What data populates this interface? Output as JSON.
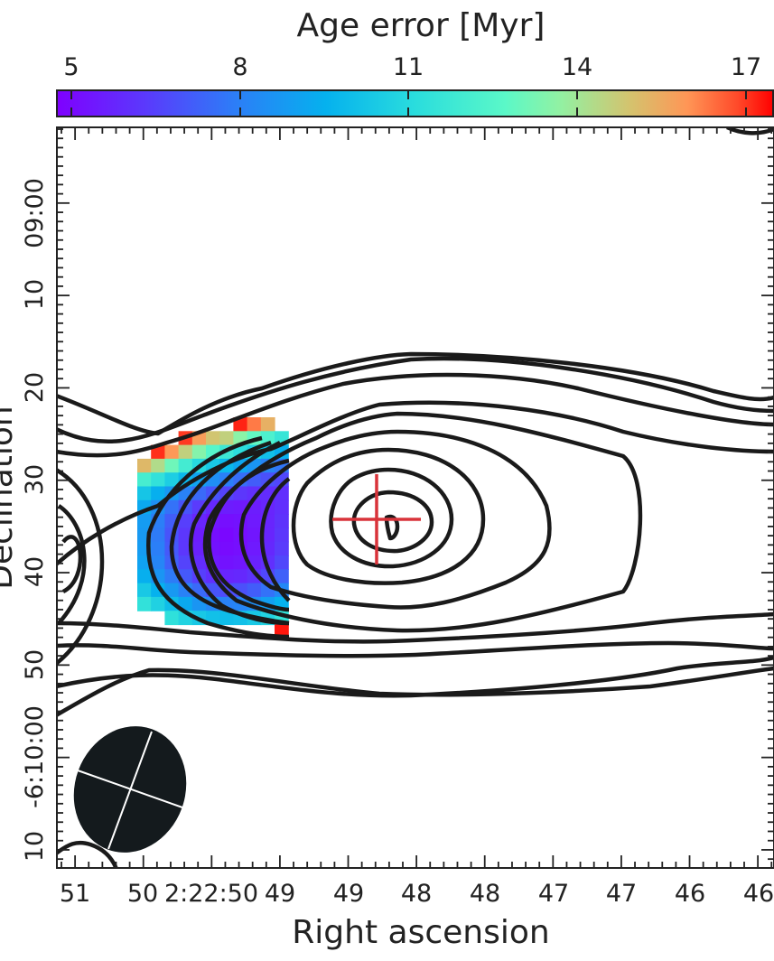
{
  "chart_data": {
    "type": "heatmap",
    "title": "",
    "colorbar": {
      "label": "Age error [Myr]",
      "ticks": [
        "5",
        "8",
        "11",
        "14",
        "17"
      ],
      "colormap": "rainbow",
      "range": [
        4.8,
        17.5
      ]
    },
    "xlabel": "Right ascension",
    "ylabel": "Declination",
    "x_tick_labels": [
      "51",
      "50",
      "2:22:50",
      "49",
      "49",
      "48",
      "48",
      "47",
      "47",
      "46",
      "46"
    ],
    "y_tick_labels": [
      "09:00",
      "10",
      "20",
      "30",
      "40",
      "50",
      "-6:10:00",
      "10"
    ],
    "heatmap_cells": [
      [
        null,
        null,
        null,
        null,
        null,
        null,
        null,
        17.2,
        16.3,
        15.4,
        null
      ],
      [
        null,
        null,
        null,
        17.0,
        15.8,
        14.9,
        14.6,
        13.6,
        12.9,
        12.3,
        11.6
      ],
      [
        null,
        17.1,
        15.9,
        14.6,
        13.5,
        12.6,
        11.8,
        11.2,
        10.7,
        10.1,
        9.5
      ],
      [
        15.2,
        14.3,
        13.1,
        12.0,
        11.0,
        10.4,
        9.8,
        9.2,
        8.7,
        8.2,
        7.8
      ],
      [
        12.1,
        11.4,
        10.6,
        9.8,
        9.1,
        8.5,
        8.0,
        7.6,
        7.2,
        6.9,
        6.7
      ],
      [
        10.3,
        9.5,
        8.8,
        8.1,
        7.5,
        7.0,
        6.6,
        6.3,
        6.1,
        6.0,
        6.1
      ],
      [
        9.3,
        8.5,
        7.7,
        7.0,
        6.4,
        5.9,
        5.6,
        5.5,
        5.6,
        5.8,
        6.1
      ],
      [
        8.9,
        8.0,
        7.2,
        6.5,
        5.8,
        5.4,
        5.2,
        5.3,
        5.5,
        5.8,
        6.2
      ],
      [
        8.8,
        7.9,
        7.0,
        6.3,
        5.6,
        5.2,
        5.0,
        5.2,
        5.4,
        5.8,
        6.3
      ],
      [
        8.9,
        8.0,
        7.1,
        6.3,
        5.7,
        5.3,
        5.1,
        5.2,
        5.5,
        5.9,
        6.4
      ],
      [
        9.1,
        8.2,
        7.3,
        6.6,
        6.0,
        5.5,
        5.3,
        5.4,
        5.7,
        6.1,
        6.7
      ],
      [
        9.5,
        8.7,
        7.9,
        7.1,
        6.5,
        6.1,
        5.8,
        5.9,
        6.2,
        6.7,
        7.3
      ],
      [
        10.4,
        9.6,
        8.8,
        8.1,
        7.5,
        7.0,
        6.8,
        6.9,
        7.2,
        7.7,
        8.3
      ],
      [
        11.4,
        10.7,
        10.0,
        9.3,
        8.7,
        8.3,
        8.1,
        8.2,
        8.5,
        9.0,
        9.6
      ],
      [
        null,
        null,
        11.3,
        10.8,
        10.4,
        10.1,
        10.0,
        10.1,
        10.4,
        10.8,
        11.5
      ],
      [
        null,
        null,
        null,
        null,
        null,
        null,
        null,
        null,
        null,
        null,
        17.3
      ]
    ],
    "contours": "10 nested closed contours in black",
    "beam": "filled black ellipse, bottom-left",
    "marker": "red cross near the central peak",
    "grid": false
  }
}
